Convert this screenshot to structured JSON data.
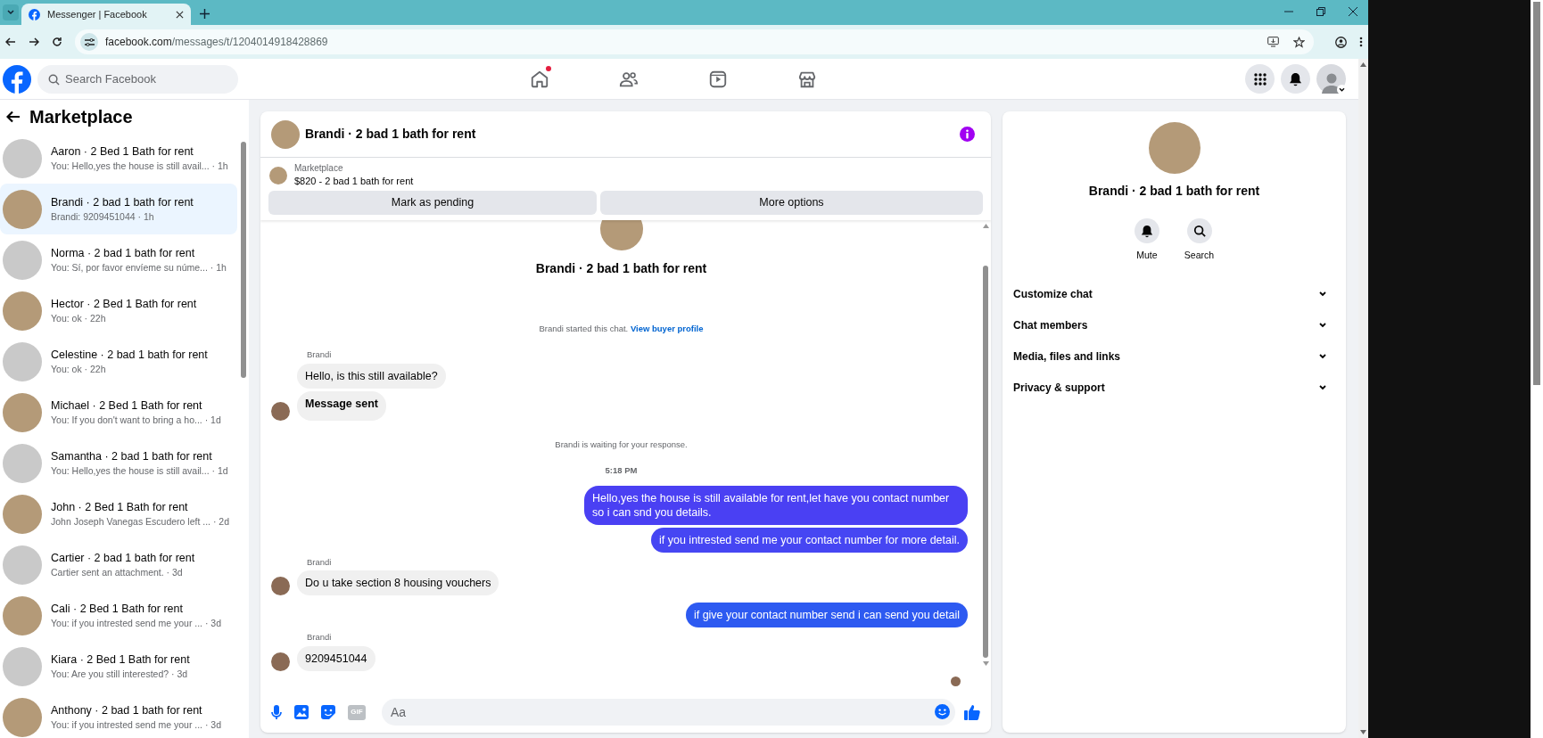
{
  "browser": {
    "tab_title": "Messenger | Facebook",
    "url_host": "facebook.com",
    "url_path": "/messages/t/1204014918428869"
  },
  "header": {
    "search_placeholder": "Search Facebook",
    "nav": [
      {
        "kind": "home",
        "notification": true
      },
      {
        "kind": "friends",
        "notification": false
      },
      {
        "kind": "video",
        "notification": false
      },
      {
        "kind": "marketplace",
        "notification": false
      }
    ]
  },
  "sidebar": {
    "title": "Marketplace",
    "conversations": [
      {
        "title": "Aaron · 2 Bed 1 Bath for rent",
        "preview": "You: Hello,yes the house is still avail... · 1h",
        "selected": false
      },
      {
        "title": "Brandi · 2 bad 1 bath for rent",
        "preview": "Brandi: 9209451044 · 1h",
        "selected": true
      },
      {
        "title": "Norma · 2 bad 1 bath for rent",
        "preview": "You: Sí, por favor envíeme su núme... · 1h",
        "selected": false
      },
      {
        "title": "Hector · 2 Bed 1 Bath for rent",
        "preview": "You: ok · 22h",
        "selected": false
      },
      {
        "title": "Celestine · 2 bad 1 bath for rent",
        "preview": "You: ok · 22h",
        "selected": false
      },
      {
        "title": "Michael · 2 Bed 1 Bath for rent",
        "preview": "You: If you don't want to bring a ho... · 1d",
        "selected": false
      },
      {
        "title": "Samantha · 2 bad 1 bath for rent",
        "preview": "You: Hello,yes the house is still avail... · 1d",
        "selected": false
      },
      {
        "title": "John · 2 Bed 1 Bath for rent",
        "preview": "John Joseph Vanegas Escudero left ... · 2d",
        "selected": false
      },
      {
        "title": "Cartier · 2 bad 1 bath for rent",
        "preview": "Cartier sent an attachment. · 3d",
        "selected": false
      },
      {
        "title": "Cali · 2 Bed 1 Bath for rent",
        "preview": "You: if you intrested send me your ... · 3d",
        "selected": false
      },
      {
        "title": "Kiara · 2 Bed 1 Bath for rent",
        "preview": "You: Are you still interested? · 3d",
        "selected": false
      },
      {
        "title": "Anthony · 2 bad 1 bath for rent",
        "preview": "You: if you intrested send me your ... · 3d",
        "selected": false
      }
    ]
  },
  "chat": {
    "title": "Brandi · 2 bad 1 bath for rent",
    "listing": {
      "label": "Marketplace",
      "text": "$820 - 2 bad 1 bath for rent"
    },
    "actions": [
      "Mark as pending",
      "More options"
    ],
    "intro": {
      "title": "Brandi · 2 bad 1 bath for rent",
      "started": "Brandi started this chat.",
      "link": "View buyer profile"
    },
    "messages": [
      {
        "kind": "sender",
        "text": "Brandi"
      },
      {
        "kind": "incoming",
        "text": "Hello, is this still available?",
        "avatar": false,
        "bold": false
      },
      {
        "kind": "incoming",
        "text": "Message sent",
        "avatar": true,
        "bold": true
      },
      {
        "kind": "notice",
        "text": "Brandi is waiting for your response."
      },
      {
        "kind": "time",
        "text": "5:18 PM"
      },
      {
        "kind": "outgoing",
        "text": "Hello,yes the house is still available for rent,let have you contact number so i can snd you details.",
        "color": "#4a40f3"
      },
      {
        "kind": "outgoing",
        "text": "if you intrested send me your contact number for more detail.",
        "color": "#4646f3"
      },
      {
        "kind": "sender",
        "text": "Brandi"
      },
      {
        "kind": "incoming",
        "text": "Do u take section 8 housing vouchers",
        "avatar": true,
        "bold": false
      },
      {
        "kind": "outgoing",
        "text": "if give your contact number send i can send you detail",
        "color": "#2d5af1"
      },
      {
        "kind": "sender",
        "text": "Brandi"
      },
      {
        "kind": "incoming",
        "text": "9209451044",
        "avatar": true,
        "bold": false
      }
    ],
    "seen": true,
    "composer": {
      "placeholder": "Aa",
      "gif_label": "GIF"
    }
  },
  "details": {
    "title": "Brandi · 2 bad 1 bath for rent",
    "actions": [
      {
        "kind": "mute",
        "label": "Mute"
      },
      {
        "kind": "search",
        "label": "Search"
      }
    ],
    "sections": [
      "Customize chat",
      "Chat members",
      "Media, files and links",
      "Privacy & support"
    ]
  }
}
